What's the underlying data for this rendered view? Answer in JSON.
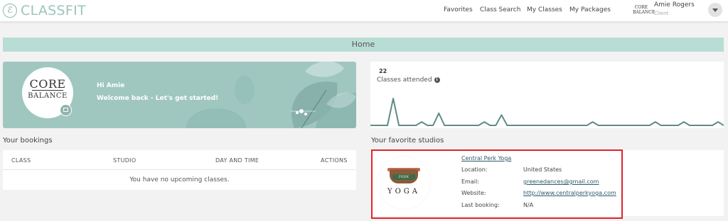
{
  "app": {
    "logo_mark": "ℰ",
    "logo_text": "CLASSFIT"
  },
  "nav": {
    "favorites": "Favorites",
    "class_search": "Class Search",
    "my_classes": "My Classes",
    "my_packages": "My Packages"
  },
  "user": {
    "avatar_line1": "CORE",
    "avatar_line2": "BALANCE",
    "name": "Amie Rogers",
    "role": "Client"
  },
  "page": {
    "title": "Home"
  },
  "hero": {
    "logo_line1": "CORE",
    "logo_line2": "BALANCE",
    "greeting": "Hi Amie",
    "welcome": "Welcome back - Let's get started!"
  },
  "stats": {
    "count": "22",
    "label": "Classes attended",
    "spark": [
      0,
      0,
      0,
      0,
      31,
      0,
      0,
      0,
      0,
      4,
      0,
      0,
      14,
      0,
      0,
      0,
      0,
      0,
      0,
      0,
      4,
      0,
      0,
      12,
      0,
      0,
      0,
      0,
      0,
      0,
      0,
      0,
      0,
      0,
      0,
      0,
      0,
      0,
      0,
      4,
      0,
      0,
      0,
      0,
      0,
      0,
      0,
      0,
      0,
      0,
      4,
      0,
      0,
      0,
      0,
      4,
      0,
      0,
      0,
      0,
      0,
      4,
      0
    ]
  },
  "bookings": {
    "section_title": "Your bookings",
    "columns": [
      "CLASS",
      "STUDIO",
      "DAY AND TIME",
      "ACTIONS"
    ],
    "empty_message": "You have no upcoming classes."
  },
  "favorites": {
    "section_title": "Your favorite studios",
    "studio": {
      "name": "Central Perk Yoga",
      "logo_cup_text": "PERK",
      "logo_word": "YOGA",
      "location_label": "Location:",
      "location": "United States",
      "email_label": "Email:",
      "email": "greenedances@gmail.com",
      "website_label": "Website:",
      "website": "http://www.centralperkyoga.com",
      "last_booking_label": "Last booking:",
      "last_booking": "N/A"
    }
  },
  "colors": {
    "accent": "#b8ddd5",
    "hero_bg": "#9fc7c0",
    "spark_line": "#5f8c86",
    "highlight": "#e0242b",
    "link": "#2e5a6b"
  }
}
